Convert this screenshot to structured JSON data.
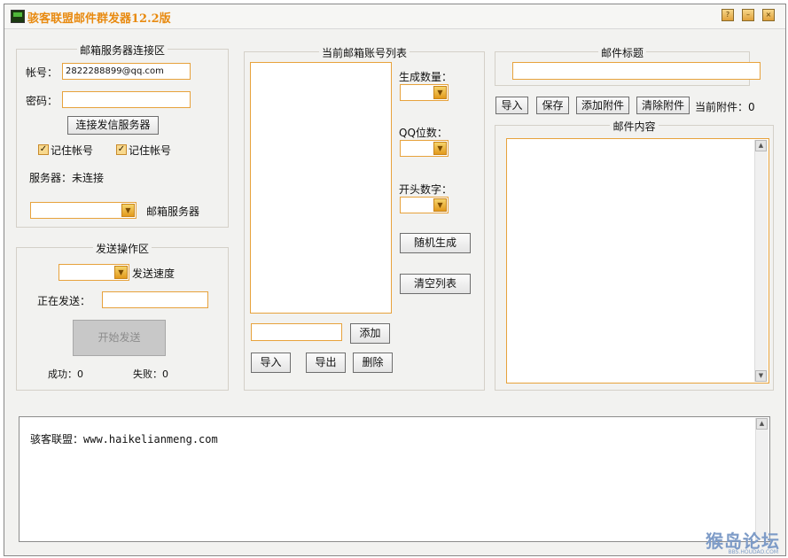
{
  "window": {
    "title": "骇客联盟邮件群发器12.2版"
  },
  "server_group": {
    "title": "邮箱服务器连接区",
    "account_label": "帐号：",
    "account_value": "2822288899@qq.com",
    "password_label": "密码：",
    "password_value": "",
    "connect_button": "连接发信服务器",
    "remember1": "记住帐号",
    "remember2": "记住帐号",
    "status_text": "服务器：未连接",
    "server_combo_value": "",
    "server_combo_label": "邮箱服务器"
  },
  "send_group": {
    "title": "发送操作区",
    "speed_combo_value": "",
    "speed_label": "发送速度",
    "sending_label": "正在发送：",
    "sending_value": "",
    "start_button": "开始发送",
    "success_text": "成功：0",
    "fail_text": "失败：0"
  },
  "accounts_group": {
    "title": "当前邮箱账号列表",
    "gen_count_label": "生成数量：",
    "qq_digits_label": "QQ位数：",
    "prefix_label": "开头数字：",
    "random_button": "随机生成",
    "clear_button": "清空列表",
    "add_input_value": "",
    "add_button": "添加",
    "import_button": "导入",
    "export_button": "导出",
    "delete_button": "删除"
  },
  "mail": {
    "subject_title": "邮件标题",
    "subject_value": "",
    "import_button": "导入",
    "save_button": "保存",
    "add_attach_button": "添加附件",
    "clear_attach_button": "清除附件",
    "current_attach_text": "当前附件：0",
    "content_title": "邮件内容"
  },
  "log": {
    "text": "骇客联盟：www.haikelianmeng.com"
  },
  "watermark": {
    "main": "猴岛论坛",
    "sub": "BBS.HOUDAO.COM"
  },
  "colors": {
    "accent_border": "#e7a23c",
    "title_color": "#e88a10",
    "panel_bg": "#f2f2f0"
  }
}
